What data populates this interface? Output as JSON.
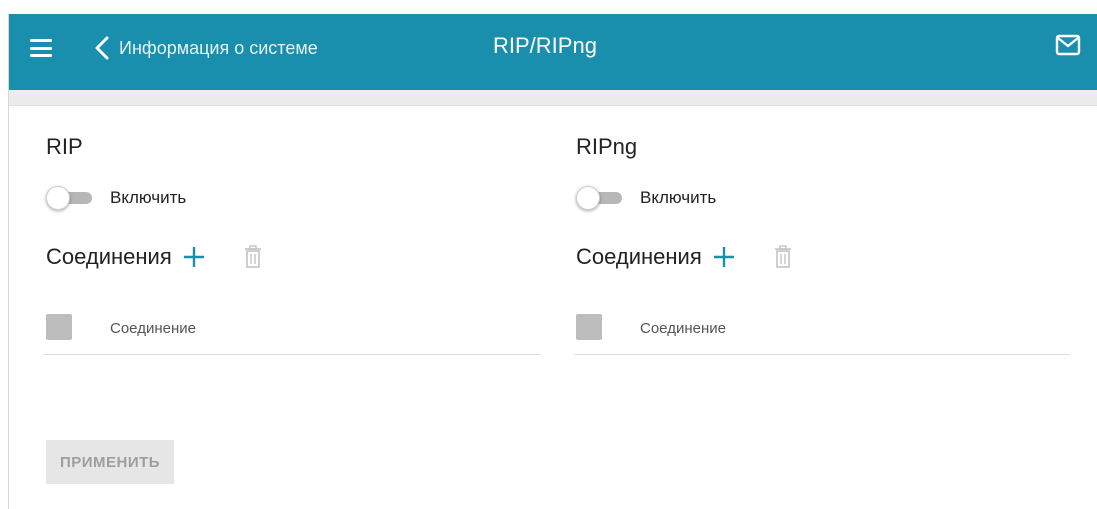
{
  "header": {
    "back_label": "Информация о системе",
    "title": "RIP/RIPng",
    "menu_icon": "hamburger-menu-icon",
    "back_icon": "chevron-left-icon",
    "mail_icon": "mail-icon",
    "background_color": "#1a8fad"
  },
  "rip": {
    "title": "RIP",
    "enable_label": "Включить",
    "enabled": false,
    "connections_title": "Соединения",
    "column_header": "Соединение"
  },
  "ripng": {
    "title": "RIPng",
    "enable_label": "Включить",
    "enabled": false,
    "connections_title": "Соединения",
    "column_header": "Соединение"
  },
  "footer": {
    "apply_label": "ПРИМЕНИТЬ",
    "apply_enabled": false
  }
}
